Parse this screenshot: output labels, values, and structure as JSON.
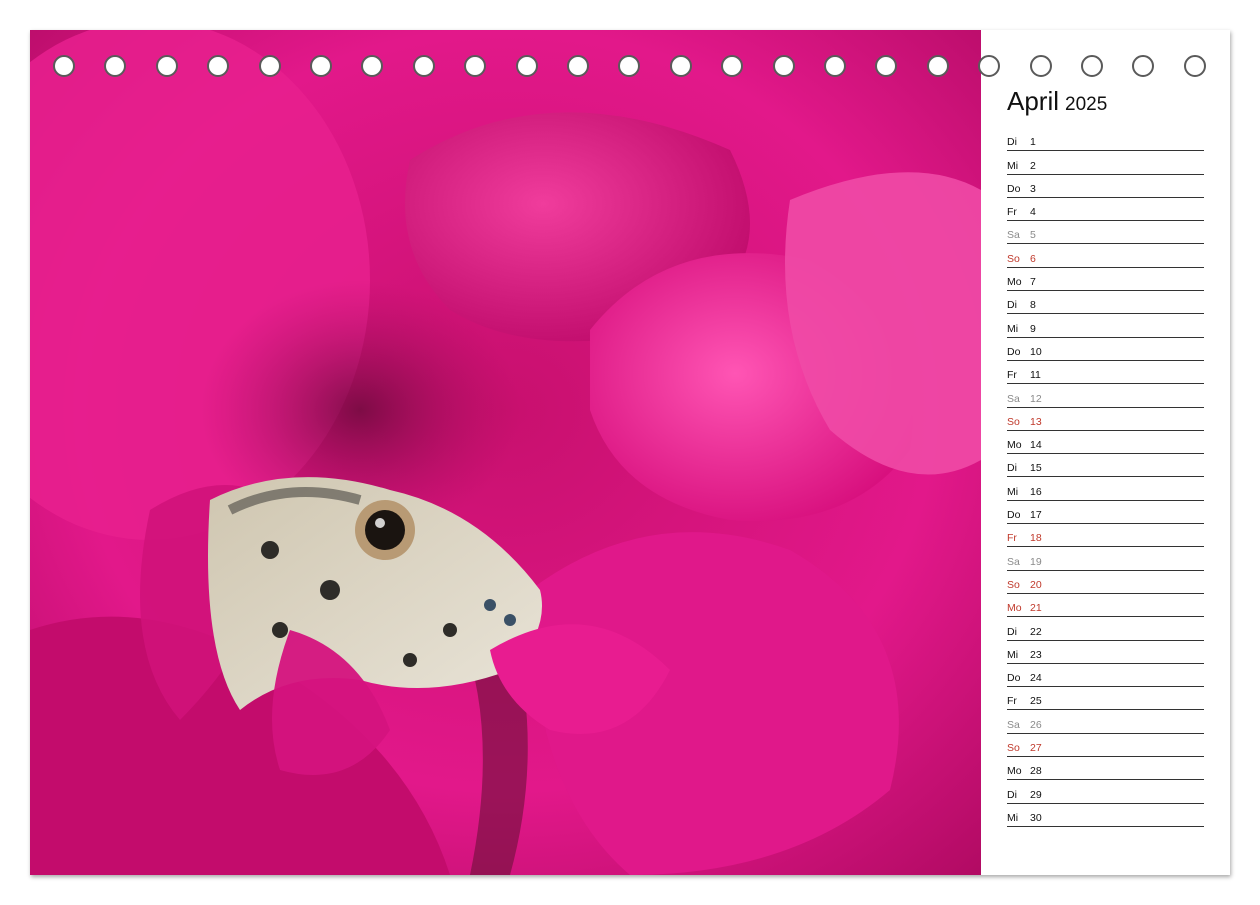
{
  "calendar": {
    "month": "April",
    "year": "2025",
    "days": [
      {
        "weekday": "Di",
        "day": "1",
        "style": "normal"
      },
      {
        "weekday": "Mi",
        "day": "2",
        "style": "normal"
      },
      {
        "weekday": "Do",
        "day": "3",
        "style": "normal"
      },
      {
        "weekday": "Fr",
        "day": "4",
        "style": "normal"
      },
      {
        "weekday": "Sa",
        "day": "5",
        "style": "sat"
      },
      {
        "weekday": "So",
        "day": "6",
        "style": "red"
      },
      {
        "weekday": "Mo",
        "day": "7",
        "style": "normal"
      },
      {
        "weekday": "Di",
        "day": "8",
        "style": "normal"
      },
      {
        "weekday": "Mi",
        "day": "9",
        "style": "normal"
      },
      {
        "weekday": "Do",
        "day": "10",
        "style": "normal"
      },
      {
        "weekday": "Fr",
        "day": "11",
        "style": "normal"
      },
      {
        "weekday": "Sa",
        "day": "12",
        "style": "sat"
      },
      {
        "weekday": "So",
        "day": "13",
        "style": "red"
      },
      {
        "weekday": "Mo",
        "day": "14",
        "style": "normal"
      },
      {
        "weekday": "Di",
        "day": "15",
        "style": "normal"
      },
      {
        "weekday": "Mi",
        "day": "16",
        "style": "normal"
      },
      {
        "weekday": "Do",
        "day": "17",
        "style": "normal"
      },
      {
        "weekday": "Fr",
        "day": "18",
        "style": "red"
      },
      {
        "weekday": "Sa",
        "day": "19",
        "style": "sat"
      },
      {
        "weekday": "So",
        "day": "20",
        "style": "red"
      },
      {
        "weekday": "Mo",
        "day": "21",
        "style": "red"
      },
      {
        "weekday": "Di",
        "day": "22",
        "style": "normal"
      },
      {
        "weekday": "Mi",
        "day": "23",
        "style": "normal"
      },
      {
        "weekday": "Do",
        "day": "24",
        "style": "normal"
      },
      {
        "weekday": "Fr",
        "day": "25",
        "style": "normal"
      },
      {
        "weekday": "Sa",
        "day": "26",
        "style": "sat"
      },
      {
        "weekday": "So",
        "day": "27",
        "style": "red"
      },
      {
        "weekday": "Mo",
        "day": "28",
        "style": "normal"
      },
      {
        "weekday": "Di",
        "day": "29",
        "style": "normal"
      },
      {
        "weekday": "Mi",
        "day": "30",
        "style": "normal"
      }
    ]
  },
  "binding": {
    "holes_over_photo": 18,
    "holes_over_calendar": 5
  },
  "colors": {
    "magenta": "#e0107e",
    "holiday_red": "#c0392b",
    "saturday_grey": "#8a8a8a"
  },
  "photo": {
    "subject_icon": "lizard-in-bougainvillea-photo"
  }
}
